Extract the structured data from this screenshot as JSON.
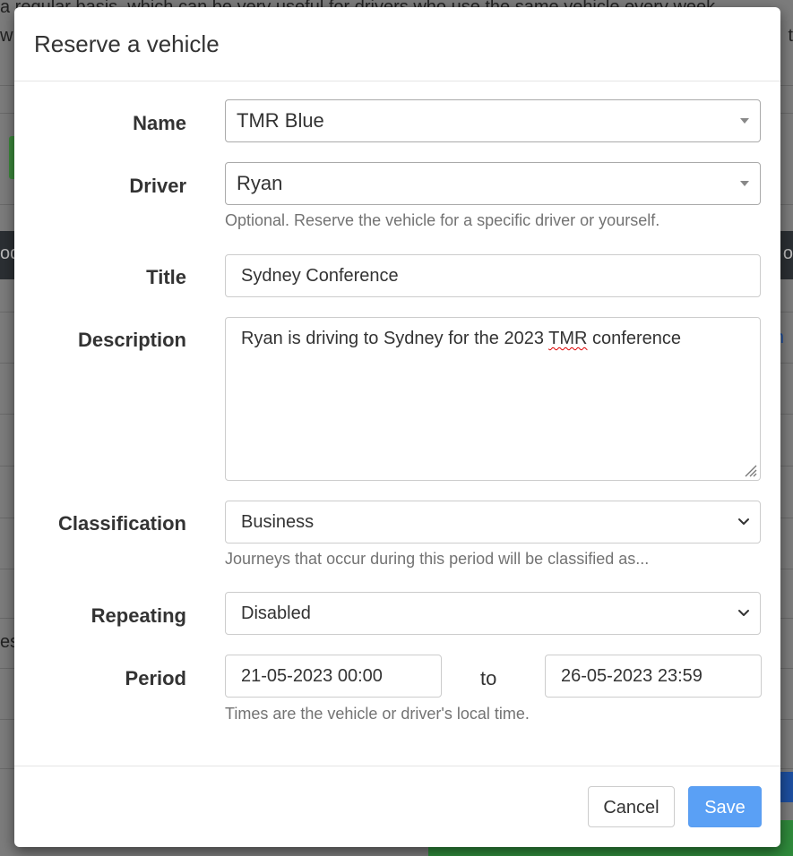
{
  "background": {
    "line1": "a regular basis, which can be very useful for drivers who use the same vehicle every week",
    "line2_left": "w",
    "line2_right": "t",
    "darkbar_left": "od",
    "darkbar_right": "o",
    "left_fragment": "es",
    "right_fragment": "n"
  },
  "modal": {
    "title": "Reserve a vehicle",
    "name": {
      "label": "Name",
      "value": "TMR Blue"
    },
    "driver": {
      "label": "Driver",
      "value": "Ryan",
      "help": "Optional. Reserve the vehicle for a specific driver or yourself."
    },
    "title_field": {
      "label": "Title",
      "value": "Sydney Conference"
    },
    "description": {
      "label": "Description",
      "value_before": "Ryan is driving to Sydney for the 2023 ",
      "value_spell": "TMR",
      "value_after": " conference"
    },
    "classification": {
      "label": "Classification",
      "value": "Business",
      "help": "Journeys that occur during this period will be classified as..."
    },
    "repeating": {
      "label": "Repeating",
      "value": "Disabled"
    },
    "period": {
      "label": "Period",
      "from": "21-05-2023 00:00",
      "to_label": "to",
      "to": "26-05-2023 23:59",
      "help": "Times are the vehicle or driver's local time."
    },
    "cancel_label": "Cancel",
    "save_label": "Save"
  },
  "colors": {
    "primary": "#5aa0f5",
    "overlay": "#7c7c7c"
  }
}
